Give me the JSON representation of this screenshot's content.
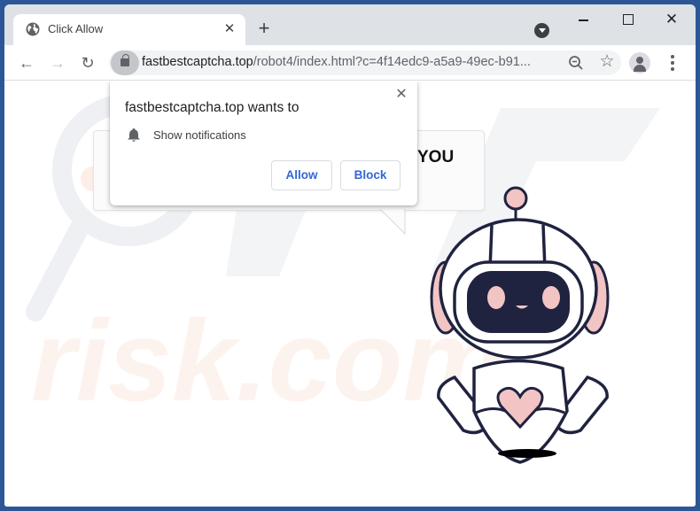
{
  "browser": {
    "tab": {
      "title": "Click Allow",
      "favicon": "globe-icon",
      "close_glyph": "✕"
    },
    "new_tab_glyph": "+",
    "window_controls": {
      "minimize": "minimize-icon",
      "maximize": "maximize-icon",
      "close_glyph": "✕"
    },
    "nav": {
      "back_glyph": "←",
      "forward_glyph": "→",
      "reload_glyph": "↻"
    },
    "address_bar": {
      "host": "fastbestcaptcha.top",
      "path": "/robot4/index.html?c=4f14edc9-a5a9-49ec-b91..."
    },
    "star_glyph": "☆"
  },
  "permission_popup": {
    "title": "fastbestcaptcha.top wants to",
    "permission": "Show notifications",
    "close_glyph": "✕",
    "allow_label": "Allow",
    "block_label": "Block"
  },
  "page": {
    "bubble_text_visible": "YOU"
  },
  "colors": {
    "frame": "#2b5797",
    "tabstrip": "#dee1e6",
    "button_text": "#3367d6",
    "robot_outline": "#1f2340",
    "robot_accent": "#f2c4c4"
  }
}
